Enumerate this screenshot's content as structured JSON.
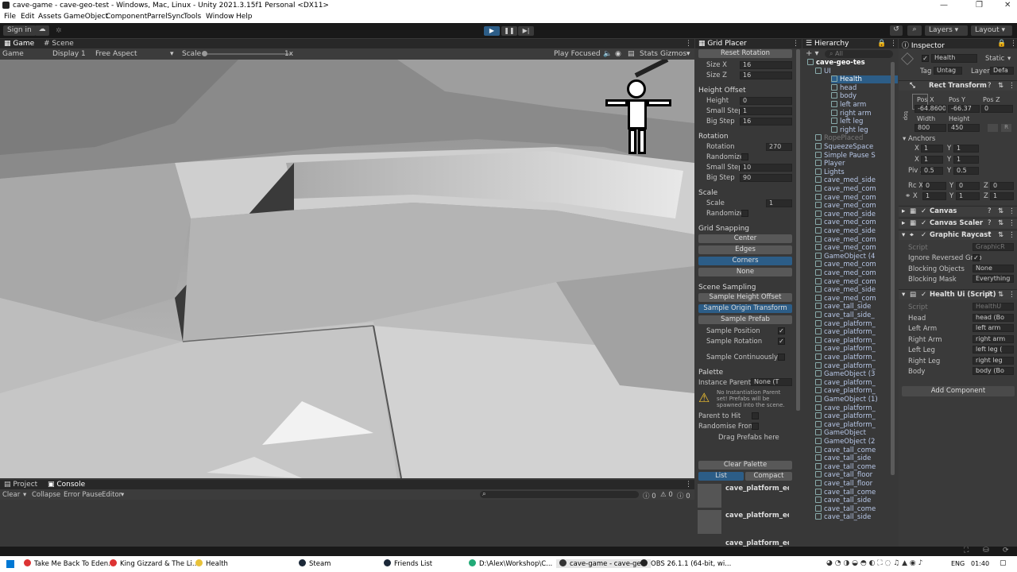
{
  "window": {
    "title": "cave-game - cave-geo-test - Windows, Mac, Linux - Unity 2021.3.15f1 Personal <DX11>"
  },
  "menu": [
    "File",
    "Edit",
    "Assets",
    "GameObject",
    "Component",
    "ParrelSync",
    "Tools",
    "Window",
    "Help"
  ],
  "toolbar": {
    "sign_in": "Sign in",
    "layers": "Layers",
    "layout": "Layout"
  },
  "game_panel": {
    "tabs": [
      "Game",
      "Scene"
    ],
    "display_mode": "Game",
    "display": "Display 1",
    "aspect": "Free Aspect",
    "scale_label": "Scale",
    "scale_value": "1x",
    "play_focused": "Play Focused",
    "stats": "Stats",
    "gizmos": "Gizmos"
  },
  "bottom_panel": {
    "tabs": [
      "Project",
      "Console"
    ],
    "clear": "Clear",
    "collapse": "Collapse",
    "error_pause": "Error Pause",
    "editor": "Editor",
    "counts": [
      "0",
      "0",
      "0"
    ]
  },
  "grid_placer": {
    "title": "Grid Placer",
    "reset_rotation": "Reset Rotation",
    "size_x_label": "Size X",
    "size_x": "16",
    "size_z_label": "Size Z",
    "size_z": "16",
    "height_offset_title": "Height Offset",
    "height_label": "Height",
    "height": "0",
    "small_step_label": "Small Step",
    "small_step": "1",
    "big_step_label": "Big Step",
    "big_step": "16",
    "rotation_title": "Rotation",
    "rotation_label": "Rotation",
    "rotation": "270",
    "randomize_label": "Randomize",
    "rot_small_step": "10",
    "rot_big_step": "90",
    "scale_title": "Scale",
    "scale_label": "Scale",
    "scale": "1",
    "grid_snapping_title": "Grid Snapping",
    "snap_center": "Center",
    "snap_edges": "Edges",
    "snap_corners": "Corners",
    "snap_none": "None",
    "scene_sampling_title": "Scene Sampling",
    "sample_height": "Sample Height Offset",
    "sample_origin": "Sample Origin Transform",
    "sample_prefab": "Sample Prefab",
    "sample_position": "Sample Position",
    "sample_rotation": "Sample Rotation",
    "sample_continuously": "Sample Continuously",
    "palette_title": "Palette",
    "instance_parent_label": "Instance Parent",
    "instance_parent_value": "None (T",
    "warning": "No Instantiation Parent set! Prefabs will be spawned into the scene.",
    "parent_to_hit": "Parent to Hit",
    "randomise_from": "Randomise From I",
    "drag_prefabs": "Drag Prefabs here",
    "clear_palette": "Clear Palette",
    "list": "List",
    "compact": "Compact",
    "palette_items": [
      "cave_platform_edge",
      "cave_platform_edge",
      "cave_platform_edge"
    ]
  },
  "hierarchy": {
    "title": "Hierarchy",
    "search_placeholder": "All",
    "items": [
      {
        "label": "cave-geo-tes",
        "indent": 0
      },
      {
        "label": "UI",
        "indent": 1
      },
      {
        "label": "Health",
        "indent": 2
      },
      {
        "label": "head",
        "indent": 3
      },
      {
        "label": "body",
        "indent": 3
      },
      {
        "label": "left arm",
        "indent": 3
      },
      {
        "label": "right arm",
        "indent": 3
      },
      {
        "label": "left leg",
        "indent": 3
      },
      {
        "label": "right leg",
        "indent": 3
      },
      {
        "label": "RopePlaced",
        "indent": 1
      },
      {
        "label": "SqueezeSpace",
        "indent": 1
      },
      {
        "label": "Simple Pause S",
        "indent": 1
      },
      {
        "label": "Player",
        "indent": 1
      },
      {
        "label": "Lights",
        "indent": 1
      },
      {
        "label": "cave_med_side",
        "indent": 1
      },
      {
        "label": "cave_med_com",
        "indent": 1
      },
      {
        "label": "cave_med_com",
        "indent": 1
      },
      {
        "label": "cave_med_com",
        "indent": 1
      },
      {
        "label": "cave_med_side",
        "indent": 1
      },
      {
        "label": "cave_med_com",
        "indent": 1
      },
      {
        "label": "cave_med_side",
        "indent": 1
      },
      {
        "label": "cave_med_com",
        "indent": 1
      },
      {
        "label": "cave_med_com",
        "indent": 1
      },
      {
        "label": "GameObject (4",
        "indent": 1
      },
      {
        "label": "cave_med_com",
        "indent": 1
      },
      {
        "label": "cave_med_com",
        "indent": 1
      },
      {
        "label": "cave_med_com",
        "indent": 1
      },
      {
        "label": "cave_med_side",
        "indent": 1
      },
      {
        "label": "cave_med_com",
        "indent": 1
      },
      {
        "label": "cave_tall_side",
        "indent": 1
      },
      {
        "label": "cave_tall_side_",
        "indent": 1
      },
      {
        "label": "cave_platform_",
        "indent": 1
      },
      {
        "label": "cave_platform_",
        "indent": 1
      },
      {
        "label": "cave_platform_",
        "indent": 1
      },
      {
        "label": "cave_platform_",
        "indent": 1
      },
      {
        "label": "cave_platform_",
        "indent": 1
      },
      {
        "label": "cave_platform_",
        "indent": 1
      },
      {
        "label": "GameObject (3",
        "indent": 1
      },
      {
        "label": "cave_platform_",
        "indent": 1
      },
      {
        "label": "cave_platform_",
        "indent": 1
      },
      {
        "label": "GameObject (1)",
        "indent": 1
      },
      {
        "label": "cave_platform_",
        "indent": 1
      },
      {
        "label": "cave_platform_",
        "indent": 1
      },
      {
        "label": "cave_platform_",
        "indent": 1
      },
      {
        "label": "GameObject",
        "indent": 1
      },
      {
        "label": "GameObject (2",
        "indent": 1
      },
      {
        "label": "cave_tall_come",
        "indent": 1
      },
      {
        "label": "cave_tall_side",
        "indent": 1
      },
      {
        "label": "cave_tall_come",
        "indent": 1
      },
      {
        "label": "cave_tall_floor",
        "indent": 1
      },
      {
        "label": "cave_tall_floor",
        "indent": 1
      },
      {
        "label": "cave_tall_come",
        "indent": 1
      },
      {
        "label": "cave_tall_side",
        "indent": 1
      },
      {
        "label": "cave_tall_come",
        "indent": 1
      },
      {
        "label": "cave_tall_side",
        "indent": 1
      }
    ]
  },
  "inspector": {
    "title": "Inspector",
    "object_name": "Health",
    "static_label": "Static",
    "tag_label": "Tag",
    "tag_value": "Untag",
    "layer_label": "Layer",
    "layer_value": "Defa",
    "rect_transform": "Rect Transform",
    "stretch_label": "top",
    "pos_x_label": "Pos X",
    "pos_x": "-64.8600",
    "pos_y_label": "Pos Y",
    "pos_y": "-66.37",
    "pos_z_label": "Pos Z",
    "pos_z": "0",
    "width_label": "Width",
    "width": "800",
    "height_label": "Height",
    "height": "450",
    "anchors_label": "Anchors",
    "anchor_min_x": "1",
    "anchor_min_y": "1",
    "anchor_max_x": "1",
    "anchor_max_y": "1",
    "pivot_label": "Piv",
    "pivot_x": "0.5",
    "pivot_y": "0.5",
    "rotation_label": "Rc",
    "rot_x": "0",
    "rot_y": "0",
    "rot_z": "0",
    "scale_x": "1",
    "scale_y": "1",
    "scale_z": "1",
    "canvas": "Canvas",
    "canvas_scaler": "Canvas Scaler",
    "graphic_raycaster": "Graphic Raycast",
    "script_label": "Script",
    "raycaster_script": "GraphicR",
    "ignore_reversed": "Ignore Reversed Grap",
    "blocking_objects_label": "Blocking Objects",
    "blocking_objects": "None",
    "blocking_mask_label": "Blocking Mask",
    "blocking_mask": "Everything",
    "health_ui": "Health Ui (Script)",
    "health_script": "HealthU",
    "fields": [
      {
        "label": "Head",
        "value": "head (Bo"
      },
      {
        "label": "Left Arm",
        "value": "left arm"
      },
      {
        "label": "Right Arm",
        "value": "right arm"
      },
      {
        "label": "Left Leg",
        "value": "left leg ("
      },
      {
        "label": "Right Leg",
        "value": "right leg"
      },
      {
        "label": "Body",
        "value": "body (Bo"
      }
    ],
    "add_component": "Add Component"
  },
  "taskbar": {
    "tasks": [
      {
        "label": "Take Me Back To Eden...",
        "color": "#d33"
      },
      {
        "label": "King Gizzard & The Li...",
        "color": "#d33"
      },
      {
        "label": "Health",
        "color": "#e8c23a"
      },
      {
        "label": "Steam",
        "color": "#1b2838"
      },
      {
        "label": "Friends List",
        "color": "#1b2838"
      },
      {
        "label": "D:\\Alex\\Workshop\\C...",
        "color": "#2a7"
      },
      {
        "label": "cave-game - cave-ge...",
        "color": "#333"
      },
      {
        "label": "OBS 26.1.1 (64-bit, wi...",
        "color": "#222"
      }
    ],
    "language": "ENG",
    "time": "01:40"
  }
}
